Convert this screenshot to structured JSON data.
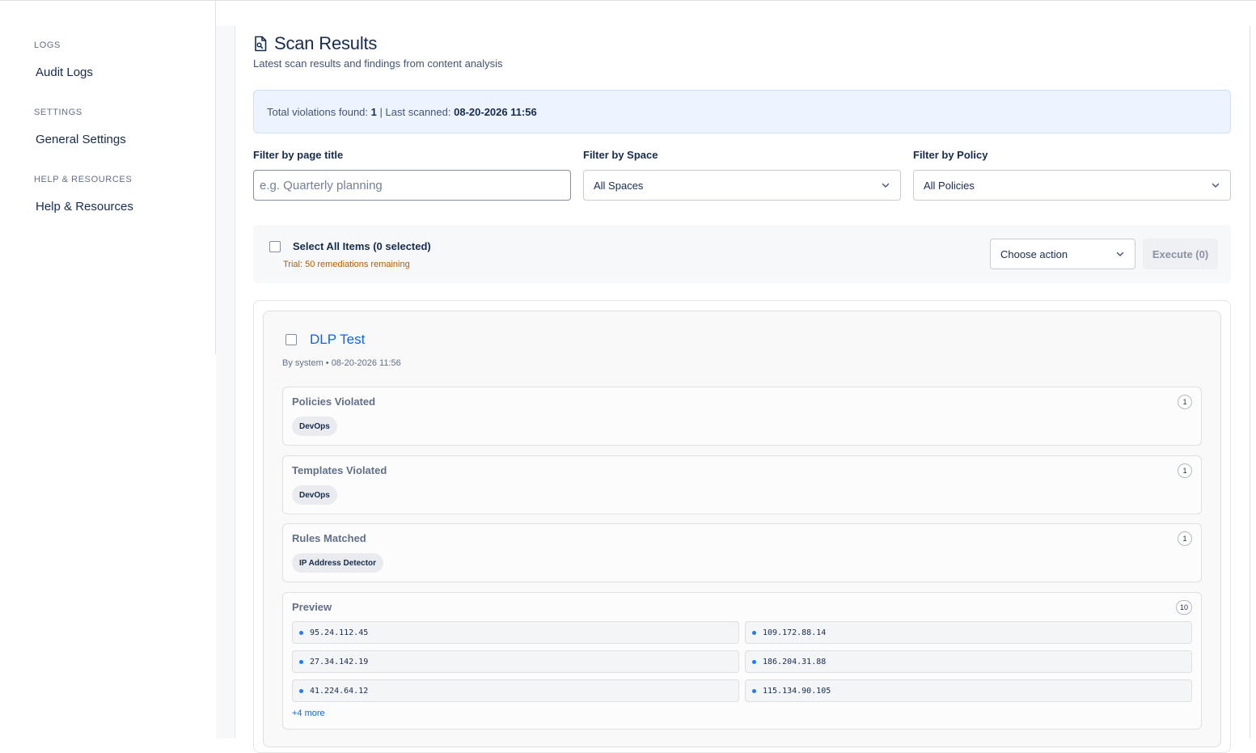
{
  "sidebar": {
    "sections": [
      {
        "heading": "LOGS",
        "item": "Audit Logs"
      },
      {
        "heading": "SETTINGS",
        "item": "General Settings"
      },
      {
        "heading": "HELP & RESOURCES",
        "item": "Help & Resources"
      }
    ]
  },
  "header": {
    "title": "Scan Results",
    "subtitle": "Latest scan results and findings from content analysis",
    "title_icon": "document-scan-icon"
  },
  "summary": {
    "violations_label": "Total violations found:",
    "violations_count": "1",
    "separator": "|",
    "scanned_label": "Last scanned:",
    "scanned_value": "08-20-2026 11:56"
  },
  "filters": {
    "title_label": "Filter by page title",
    "title_placeholder": "e.g. Quarterly planning",
    "space_label": "Filter by Space",
    "space_value": "All Spaces",
    "policy_label": "Filter by Policy",
    "policy_value": "All Policies"
  },
  "bulk": {
    "select_all_label": "Select All Items (0 selected)",
    "trial_text": "Trial: 50 remediations remaining",
    "action_placeholder": "Choose action",
    "execute_label": "Execute (0)"
  },
  "result": {
    "title": "DLP Test",
    "meta": "By system • 08-20-2026 11:56",
    "policies": {
      "title": "Policies Violated",
      "count": "1",
      "tag": "DevOps"
    },
    "templates": {
      "title": "Templates Violated",
      "count": "1",
      "tag": "DevOps"
    },
    "rules": {
      "title": "Rules Matched",
      "count": "1",
      "tag": "IP Address Detector"
    },
    "preview": {
      "title": "Preview",
      "count": "10",
      "items": [
        "95.24.112.45",
        "109.172.88.14",
        "27.34.142.19",
        "186.204.31.88",
        "41.224.64.12",
        "115.134.90.105"
      ],
      "more": "+4 more"
    }
  },
  "colors": {
    "accent": "#0c66e4",
    "summary_bg": "#edf4ff",
    "trial": "#b65c02",
    "dot": "#1d7afc"
  }
}
